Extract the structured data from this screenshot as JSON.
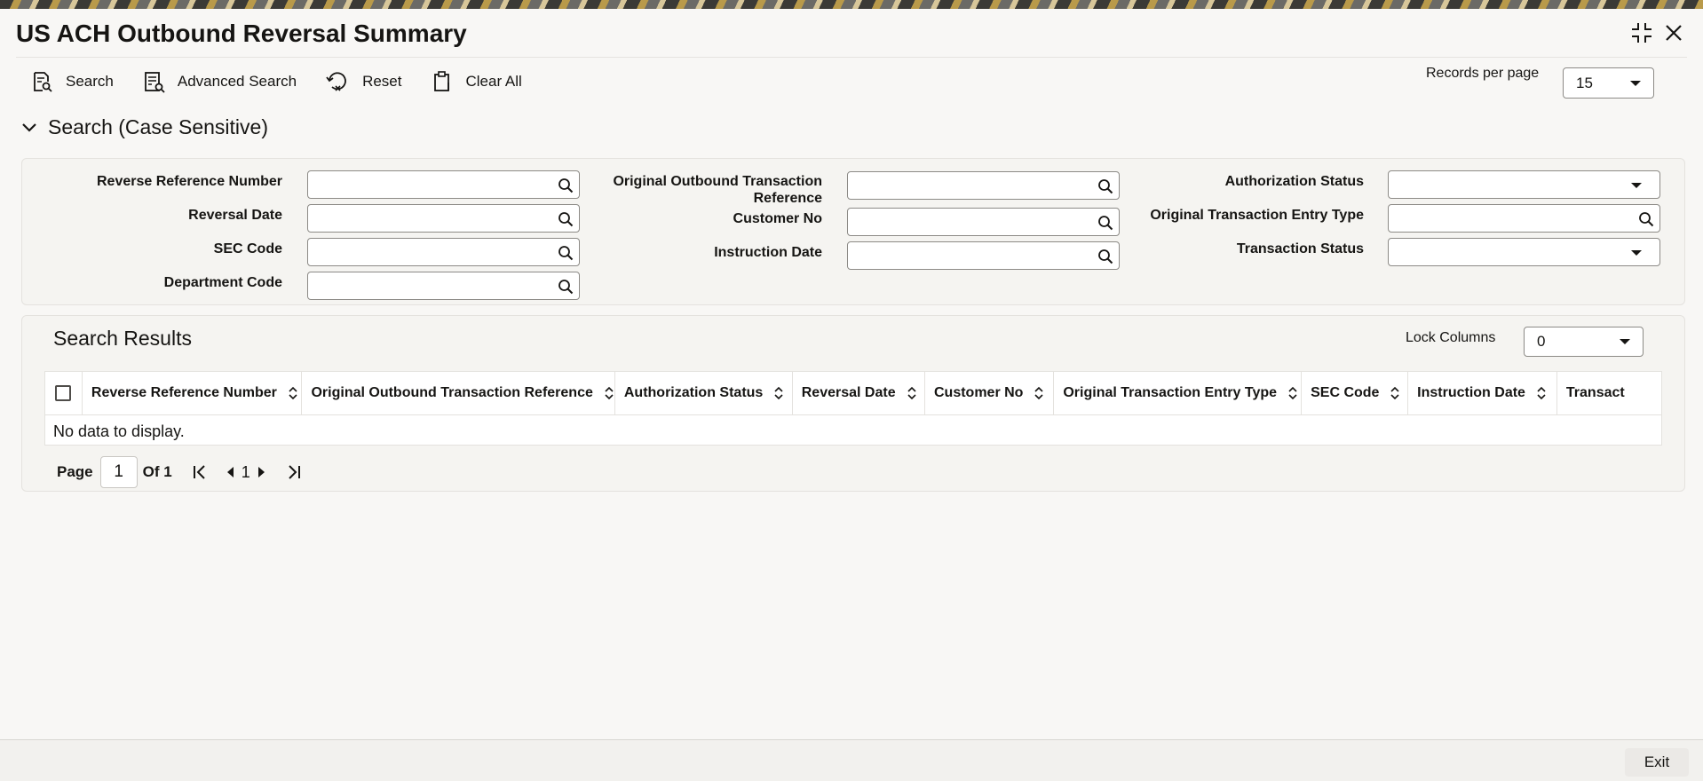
{
  "window": {
    "title": "US ACH Outbound Reversal Summary"
  },
  "toolbar": {
    "search_label": "Search",
    "advanced_search_label": "Advanced Search",
    "reset_label": "Reset",
    "clear_all_label": "Clear All",
    "records_per_page_label": "Records per page",
    "records_per_page_value": "15"
  },
  "search_section": {
    "title": "Search (Case Sensitive)",
    "fields": {
      "reverse_reference_number": "Reverse Reference Number",
      "reversal_date": "Reversal Date",
      "sec_code": "SEC Code",
      "department_code": "Department Code",
      "original_outbound_transaction_reference_line1": "Original Outbound Transaction",
      "original_outbound_transaction_reference_line2": "Reference",
      "customer_no": "Customer No",
      "instruction_date": "Instruction Date",
      "authorization_status": "Authorization Status",
      "original_transaction_entry_type": "Original Transaction Entry Type",
      "transaction_status": "Transaction Status"
    }
  },
  "results": {
    "title": "Search Results",
    "lock_columns_label": "Lock Columns",
    "lock_columns_value": "0",
    "columns": [
      "Reverse Reference Number",
      "Original Outbound Transaction Reference",
      "Authorization Status",
      "Reversal Date",
      "Customer No",
      "Original Transaction Entry Type",
      "SEC Code",
      "Instruction Date",
      "Transact"
    ],
    "empty_text": "No data to display."
  },
  "pagination": {
    "page_label": "Page",
    "page_value": "1",
    "of_label": "Of 1",
    "current_page": "1"
  },
  "footer": {
    "exit_label": "Exit"
  }
}
